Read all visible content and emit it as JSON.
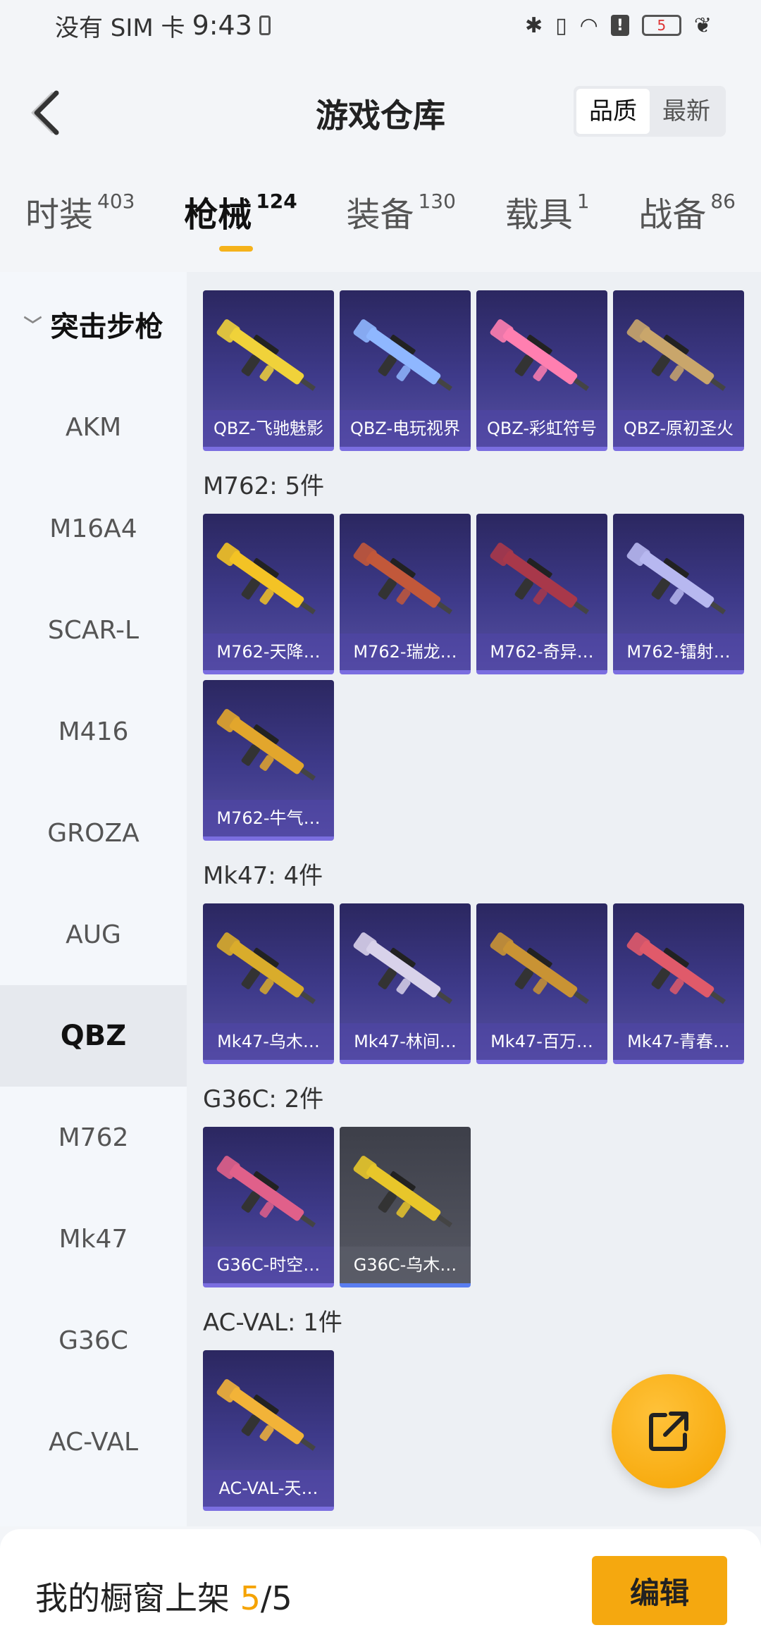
{
  "status_bar": {
    "carrier": "没有 SIM 卡",
    "time": "9:43",
    "battery": "5"
  },
  "header": {
    "title": "游戏仓库",
    "sort_options": [
      "品质",
      "最新"
    ],
    "sort_active": "品质"
  },
  "tabs": [
    {
      "label": "时装",
      "count": "403"
    },
    {
      "label": "枪械",
      "count": "124",
      "active": true
    },
    {
      "label": "装备",
      "count": "130"
    },
    {
      "label": "载具",
      "count": "1"
    },
    {
      "label": "战备",
      "count": "86"
    }
  ],
  "sidebar": {
    "category": "突击步枪",
    "items": [
      "AKM",
      "M16A4",
      "SCAR-L",
      "M416",
      "GROZA",
      "AUG",
      "QBZ",
      "M762",
      "Mk47",
      "G36C",
      "AC-VAL"
    ],
    "active": "QBZ"
  },
  "sections": [
    {
      "title": "",
      "items": [
        {
          "label": "QBZ-飞驰魅影",
          "color": "#f0d23a"
        },
        {
          "label": "QBZ-电玩视界",
          "color": "#8fb7ff"
        },
        {
          "label": "QBZ-彩虹符号",
          "color": "#ff7fb0"
        },
        {
          "label": "QBZ-原初圣火",
          "color": "#c9a66b"
        }
      ]
    },
    {
      "title": "M762: 5件",
      "items": [
        {
          "label": "M762-天降…",
          "color": "#f3c325"
        },
        {
          "label": "M762-瑞龙…",
          "color": "#c2583a"
        },
        {
          "label": "M762-奇异…",
          "color": "#a8384a"
        },
        {
          "label": "M762-镭射…",
          "color": "#b7b8f0"
        },
        {
          "label": "M762-牛气…",
          "color": "#e2a62c"
        }
      ]
    },
    {
      "title": "Mk47: 4件",
      "items": [
        {
          "label": "Mk47-乌木…",
          "color": "#d9ac2b"
        },
        {
          "label": "Mk47-林间…",
          "color": "#d8d2ea"
        },
        {
          "label": "Mk47-百万…",
          "color": "#c99334"
        },
        {
          "label": "Mk47-青春…",
          "color": "#e05a6a"
        }
      ]
    },
    {
      "title": "G36C: 2件",
      "items": [
        {
          "label": "G36C-时空…",
          "color": "#e0608a"
        },
        {
          "label": "G36C-乌木…",
          "color": "#e8c62a",
          "grey": true
        }
      ]
    },
    {
      "title": "AC-VAL: 1件",
      "items": [
        {
          "label": "AC-VAL-天…",
          "color": "#f2b338"
        }
      ]
    }
  ],
  "bottom_bar": {
    "label": "我的橱窗上架",
    "current": "5",
    "total": "/5",
    "edit_label": "编辑"
  }
}
